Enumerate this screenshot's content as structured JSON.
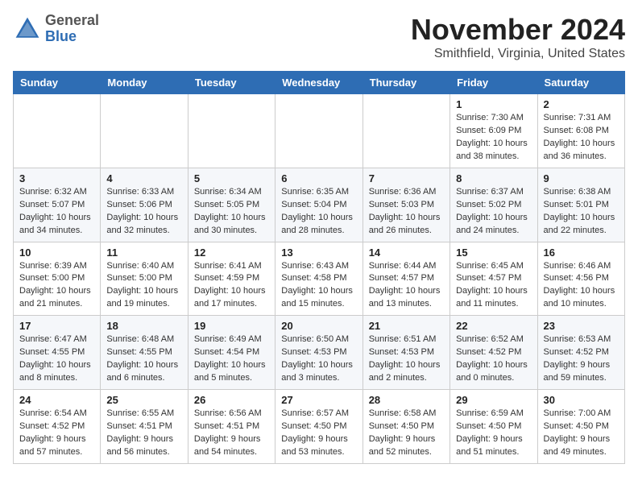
{
  "header": {
    "logo_general": "General",
    "logo_blue": "Blue",
    "month": "November 2024",
    "location": "Smithfield, Virginia, United States"
  },
  "weekdays": [
    "Sunday",
    "Monday",
    "Tuesday",
    "Wednesday",
    "Thursday",
    "Friday",
    "Saturday"
  ],
  "weeks": [
    [
      {
        "day": "",
        "info": ""
      },
      {
        "day": "",
        "info": ""
      },
      {
        "day": "",
        "info": ""
      },
      {
        "day": "",
        "info": ""
      },
      {
        "day": "",
        "info": ""
      },
      {
        "day": "1",
        "info": "Sunrise: 7:30 AM\nSunset: 6:09 PM\nDaylight: 10 hours\nand 38 minutes."
      },
      {
        "day": "2",
        "info": "Sunrise: 7:31 AM\nSunset: 6:08 PM\nDaylight: 10 hours\nand 36 minutes."
      }
    ],
    [
      {
        "day": "3",
        "info": "Sunrise: 6:32 AM\nSunset: 5:07 PM\nDaylight: 10 hours\nand 34 minutes."
      },
      {
        "day": "4",
        "info": "Sunrise: 6:33 AM\nSunset: 5:06 PM\nDaylight: 10 hours\nand 32 minutes."
      },
      {
        "day": "5",
        "info": "Sunrise: 6:34 AM\nSunset: 5:05 PM\nDaylight: 10 hours\nand 30 minutes."
      },
      {
        "day": "6",
        "info": "Sunrise: 6:35 AM\nSunset: 5:04 PM\nDaylight: 10 hours\nand 28 minutes."
      },
      {
        "day": "7",
        "info": "Sunrise: 6:36 AM\nSunset: 5:03 PM\nDaylight: 10 hours\nand 26 minutes."
      },
      {
        "day": "8",
        "info": "Sunrise: 6:37 AM\nSunset: 5:02 PM\nDaylight: 10 hours\nand 24 minutes."
      },
      {
        "day": "9",
        "info": "Sunrise: 6:38 AM\nSunset: 5:01 PM\nDaylight: 10 hours\nand 22 minutes."
      }
    ],
    [
      {
        "day": "10",
        "info": "Sunrise: 6:39 AM\nSunset: 5:00 PM\nDaylight: 10 hours\nand 21 minutes."
      },
      {
        "day": "11",
        "info": "Sunrise: 6:40 AM\nSunset: 5:00 PM\nDaylight: 10 hours\nand 19 minutes."
      },
      {
        "day": "12",
        "info": "Sunrise: 6:41 AM\nSunset: 4:59 PM\nDaylight: 10 hours\nand 17 minutes."
      },
      {
        "day": "13",
        "info": "Sunrise: 6:43 AM\nSunset: 4:58 PM\nDaylight: 10 hours\nand 15 minutes."
      },
      {
        "day": "14",
        "info": "Sunrise: 6:44 AM\nSunset: 4:57 PM\nDaylight: 10 hours\nand 13 minutes."
      },
      {
        "day": "15",
        "info": "Sunrise: 6:45 AM\nSunset: 4:57 PM\nDaylight: 10 hours\nand 11 minutes."
      },
      {
        "day": "16",
        "info": "Sunrise: 6:46 AM\nSunset: 4:56 PM\nDaylight: 10 hours\nand 10 minutes."
      }
    ],
    [
      {
        "day": "17",
        "info": "Sunrise: 6:47 AM\nSunset: 4:55 PM\nDaylight: 10 hours\nand 8 minutes."
      },
      {
        "day": "18",
        "info": "Sunrise: 6:48 AM\nSunset: 4:55 PM\nDaylight: 10 hours\nand 6 minutes."
      },
      {
        "day": "19",
        "info": "Sunrise: 6:49 AM\nSunset: 4:54 PM\nDaylight: 10 hours\nand 5 minutes."
      },
      {
        "day": "20",
        "info": "Sunrise: 6:50 AM\nSunset: 4:53 PM\nDaylight: 10 hours\nand 3 minutes."
      },
      {
        "day": "21",
        "info": "Sunrise: 6:51 AM\nSunset: 4:53 PM\nDaylight: 10 hours\nand 2 minutes."
      },
      {
        "day": "22",
        "info": "Sunrise: 6:52 AM\nSunset: 4:52 PM\nDaylight: 10 hours\nand 0 minutes."
      },
      {
        "day": "23",
        "info": "Sunrise: 6:53 AM\nSunset: 4:52 PM\nDaylight: 9 hours\nand 59 minutes."
      }
    ],
    [
      {
        "day": "24",
        "info": "Sunrise: 6:54 AM\nSunset: 4:52 PM\nDaylight: 9 hours\nand 57 minutes."
      },
      {
        "day": "25",
        "info": "Sunrise: 6:55 AM\nSunset: 4:51 PM\nDaylight: 9 hours\nand 56 minutes."
      },
      {
        "day": "26",
        "info": "Sunrise: 6:56 AM\nSunset: 4:51 PM\nDaylight: 9 hours\nand 54 minutes."
      },
      {
        "day": "27",
        "info": "Sunrise: 6:57 AM\nSunset: 4:50 PM\nDaylight: 9 hours\nand 53 minutes."
      },
      {
        "day": "28",
        "info": "Sunrise: 6:58 AM\nSunset: 4:50 PM\nDaylight: 9 hours\nand 52 minutes."
      },
      {
        "day": "29",
        "info": "Sunrise: 6:59 AM\nSunset: 4:50 PM\nDaylight: 9 hours\nand 51 minutes."
      },
      {
        "day": "30",
        "info": "Sunrise: 7:00 AM\nSunset: 4:50 PM\nDaylight: 9 hours\nand 49 minutes."
      }
    ]
  ]
}
